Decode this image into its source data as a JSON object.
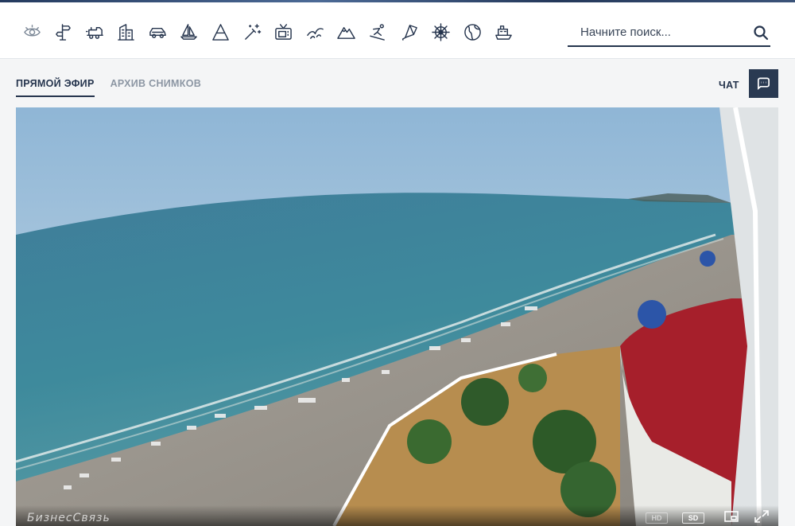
{
  "header": {
    "categories": [
      {
        "icon": "eye-icon",
        "label": ""
      },
      {
        "icon": "signpost-icon",
        "label": ""
      },
      {
        "icon": "train-icon",
        "label": ""
      },
      {
        "icon": "building-icon",
        "label": ""
      },
      {
        "icon": "car-icon",
        "label": ""
      },
      {
        "icon": "sailboat-icon",
        "label": ""
      },
      {
        "icon": "mountain-peak-icon",
        "label": ""
      },
      {
        "icon": "magic-wand-icon",
        "label": ""
      },
      {
        "icon": "tv-icon",
        "label": ""
      },
      {
        "icon": "birds-icon",
        "label": ""
      },
      {
        "icon": "mountains-icon",
        "label": ""
      },
      {
        "icon": "skier-icon",
        "label": ""
      },
      {
        "icon": "kite-icon",
        "label": ""
      },
      {
        "icon": "helm-icon",
        "label": ""
      },
      {
        "icon": "globe-icon",
        "label": ""
      },
      {
        "icon": "ship-icon",
        "label": ""
      }
    ],
    "search": {
      "placeholder": "Начните поиск..."
    }
  },
  "tabs": [
    {
      "label": "ПРЯМОЙ ЭФИР",
      "active": true
    },
    {
      "label": "АРХИВ СНИМКОВ",
      "active": false
    }
  ],
  "chat": {
    "label": "ЧАТ"
  },
  "player": {
    "watermark": "БизнесСвязь",
    "quality": [
      {
        "label": "HD",
        "active": false
      },
      {
        "label": "SD",
        "active": true
      }
    ]
  },
  "colors": {
    "brand_dark": "#25344d",
    "chat_button": "#2a3a52",
    "tab_inactive": "#8c96a3"
  }
}
